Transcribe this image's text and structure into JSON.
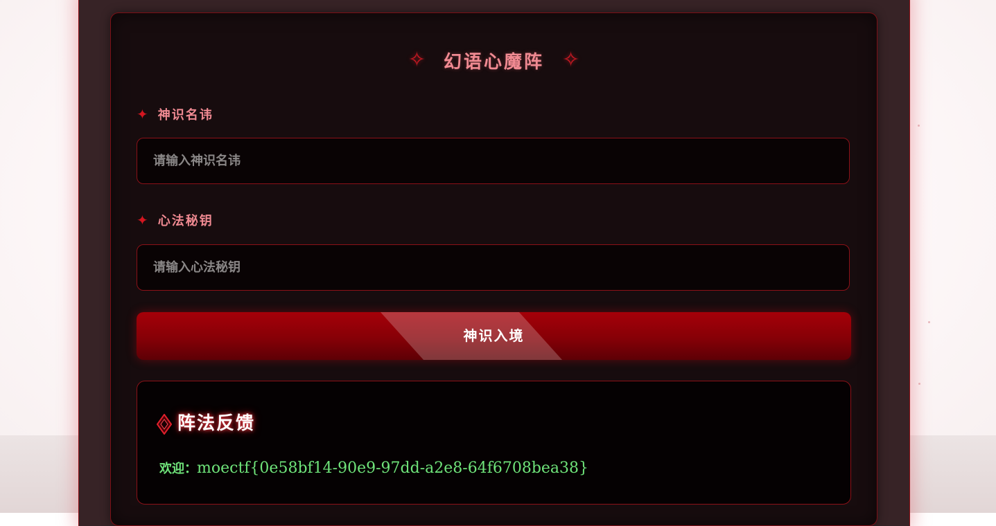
{
  "login_panel": {
    "title": "幻语心魔阵",
    "title_ornament": "✧",
    "username": {
      "label": "神识名讳",
      "placeholder": "请输入神识名讳",
      "value": ""
    },
    "password": {
      "label": "心法秘钥",
      "placeholder": "请输入心法秘钥",
      "value": ""
    },
    "label_ornament": "✦",
    "submit_label": "神识入境"
  },
  "feedback": {
    "title": "阵法反馈",
    "welcome_label": "欢迎：",
    "message": "moectf{0e58bf14-90e9-97dd-a2e8-64f6708bea38}"
  },
  "colors": {
    "accent_red": "#c41822",
    "title_pink": "#f08a92",
    "success_green": "#6fe47a",
    "panel_bg": "#170c0e"
  }
}
